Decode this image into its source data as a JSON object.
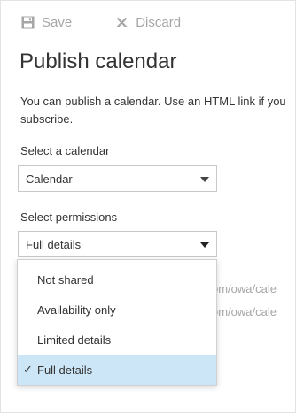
{
  "toolbar": {
    "save_label": "Save",
    "save_icon": "floppy-disk-icon",
    "discard_label": "Discard",
    "discard_icon": "close-icon",
    "disabled_color": "#a6a6a6"
  },
  "page_title": "Publish calendar",
  "description": {
    "line1": "You can publish a calendar. Use an HTML link if you",
    "line2": "subscribe."
  },
  "calendar_select": {
    "label": "Select a calendar",
    "value": "Calendar"
  },
  "permissions_select": {
    "label": "Select permissions",
    "value": "Full details",
    "options": [
      "Not shared",
      "Availability only",
      "Limited details",
      "Full details"
    ],
    "selected_index": 3,
    "check_icon": "checkmark-icon",
    "selected_bg": "#cde6f7"
  },
  "background_links": {
    "link1": "om/owa/cale",
    "link2": "om/owa/cale"
  }
}
